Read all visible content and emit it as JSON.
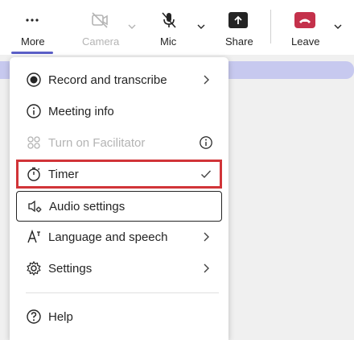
{
  "toolbar": {
    "more": {
      "label": "More",
      "icon": "more-horizontal-icon"
    },
    "camera": {
      "label": "Camera",
      "icon": "camera-off-icon",
      "disabled": true
    },
    "mic": {
      "label": "Mic",
      "icon": "mic-off-icon"
    },
    "share": {
      "label": "Share",
      "icon": "share-screen-icon"
    },
    "leave": {
      "label": "Leave",
      "icon": "phone-hangup-icon"
    }
  },
  "menu": {
    "items": [
      {
        "label": "Record and transcribe",
        "icon": "record-icon",
        "trailing": "chevron-right-icon"
      },
      {
        "label": "Meeting info",
        "icon": "info-icon"
      },
      {
        "label": "Turn on Facilitator",
        "icon": "facilitator-icon",
        "trailing": "info-icon",
        "disabled": true
      },
      {
        "label": "Timer",
        "icon": "timer-icon",
        "trailing": "checkmark-icon"
      },
      {
        "label": "Audio settings",
        "icon": "speaker-settings-icon"
      },
      {
        "label": "Language and speech",
        "icon": "language-icon",
        "trailing": "chevron-right-icon"
      },
      {
        "label": "Settings",
        "icon": "gear-icon",
        "trailing": "chevron-right-icon"
      },
      {
        "label": "Help",
        "icon": "help-icon"
      }
    ]
  },
  "colors": {
    "accent": "#5b5fc7",
    "leave": "#c4314b",
    "highlight_border": "#d13438",
    "disabled_text": "#b4b4b4"
  }
}
